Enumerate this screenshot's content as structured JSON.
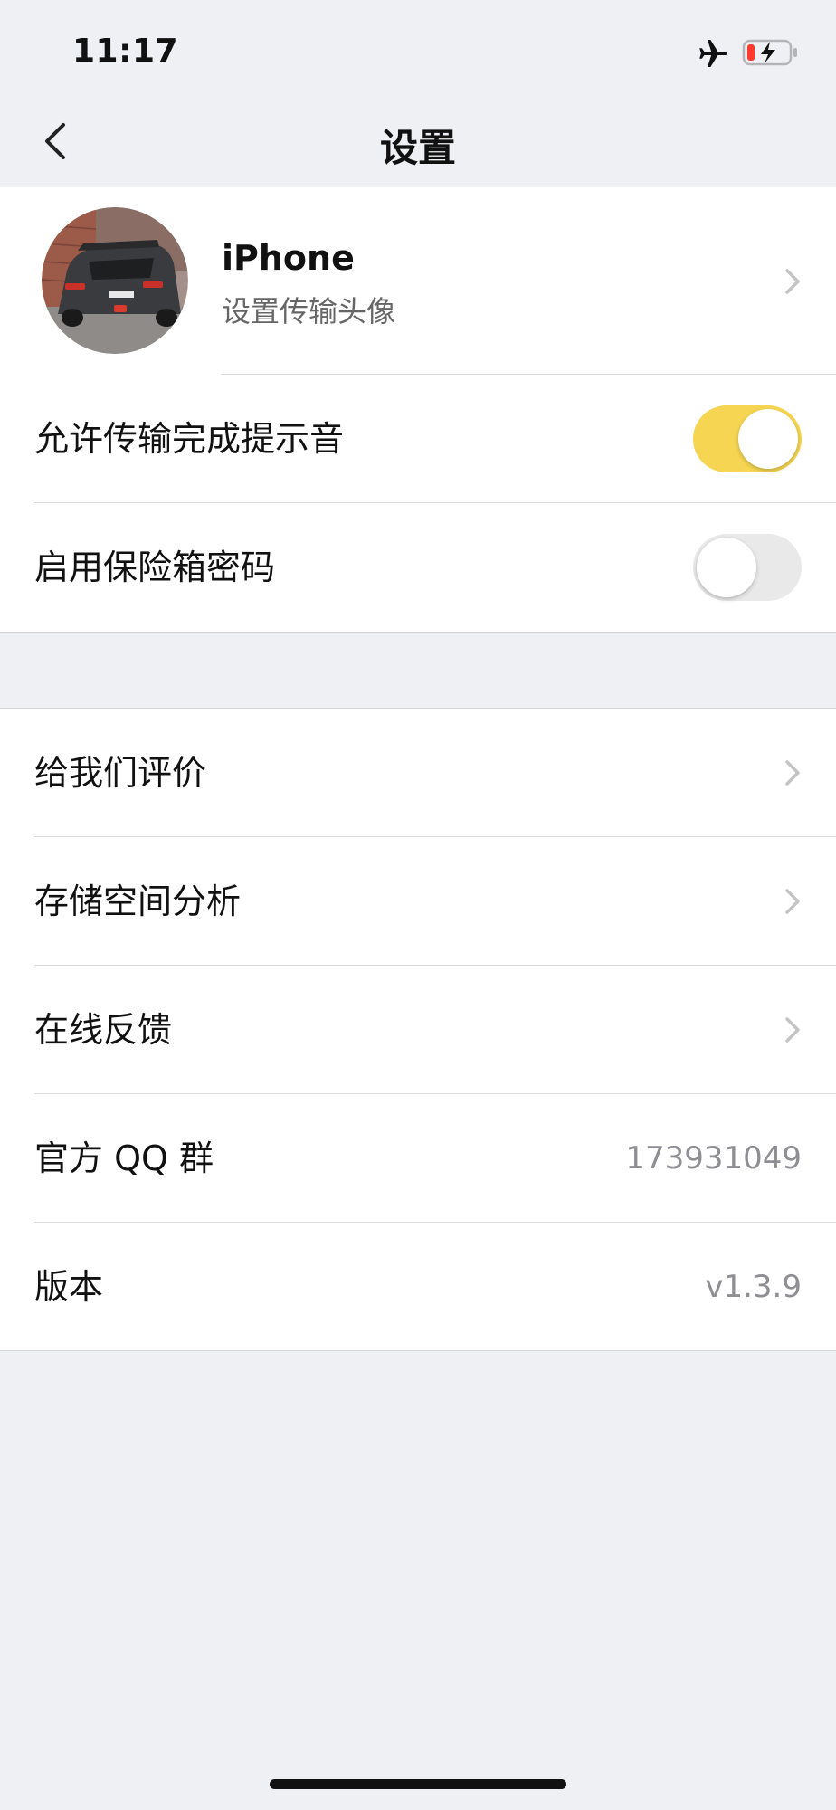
{
  "status_bar": {
    "time": "11:17"
  },
  "nav": {
    "title": "设置"
  },
  "profile": {
    "name": "iPhone",
    "subtitle": "设置传输头像"
  },
  "toggles": {
    "transfer_sound": {
      "label": "允许传输完成提示音",
      "on": true
    },
    "vault_password": {
      "label": "启用保险箱密码",
      "on": false
    }
  },
  "menu": {
    "rate_us": "给我们评价",
    "storage_analysis": "存储空间分析",
    "feedback": "在线反馈",
    "qq_group": {
      "label": "官方 QQ 群",
      "value": "173931049"
    },
    "version": {
      "label": "版本",
      "value": "v1.3.9"
    }
  },
  "colors": {
    "accent": "#f5d551",
    "background": "#eff0f4",
    "battery_low": "#ff3b30"
  },
  "icons": [
    "airplane-mode-icon",
    "battery-charging-icon",
    "back-chevron-icon",
    "chevron-right-icon"
  ]
}
